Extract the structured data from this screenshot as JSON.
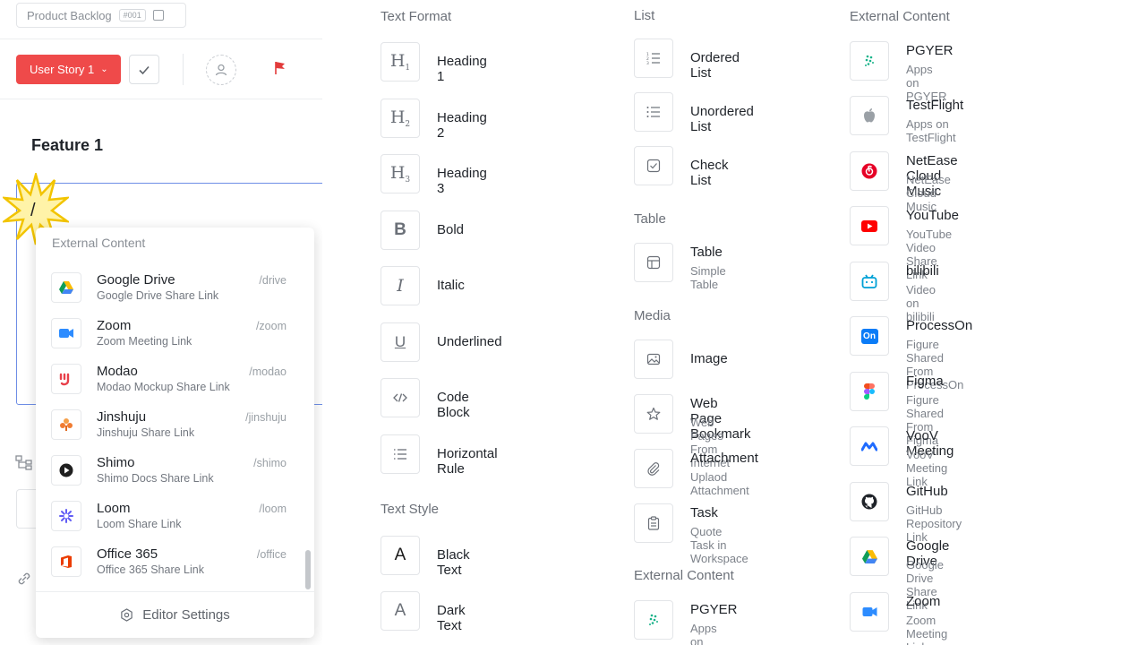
{
  "editor": {
    "breadcrumb": "Product Backlog",
    "breadcrumb_id": "#001",
    "story_button": "User Story 1",
    "feature_title": "Feature 1",
    "slash_input": "/"
  },
  "dropdown": {
    "heading": "External Content",
    "items": [
      {
        "name": "Google Drive",
        "sub": "Google Drive Share Link",
        "cmd": "/drive",
        "icon": "google-drive-icon"
      },
      {
        "name": "Zoom",
        "sub": "Zoom Meeting Link",
        "cmd": "/zoom",
        "icon": "zoom-icon"
      },
      {
        "name": "Modao",
        "sub": "Modao Mockup Share Link",
        "cmd": "/modao",
        "icon": "modao-icon"
      },
      {
        "name": "Jinshuju",
        "sub": "Jinshuju Share Link",
        "cmd": "/jinshuju",
        "icon": "jinshuju-icon"
      },
      {
        "name": "Shimo",
        "sub": "Shimo Docs Share Link",
        "cmd": "/shimo",
        "icon": "shimo-icon"
      },
      {
        "name": "Loom",
        "sub": "Loom Share Link",
        "cmd": "/loom",
        "icon": "loom-icon"
      },
      {
        "name": "Office 365",
        "sub": "Office 365 Share Link",
        "cmd": "/office",
        "icon": "office-365-icon"
      }
    ],
    "footer": "Editor Settings"
  },
  "col1": {
    "text_format_heading": "Text Format",
    "text_format": [
      {
        "name": "Heading 1",
        "icon": "heading-1-icon"
      },
      {
        "name": "Heading 2",
        "icon": "heading-2-icon"
      },
      {
        "name": "Heading 3",
        "icon": "heading-3-icon"
      },
      {
        "name": "Bold",
        "icon": "bold-icon"
      },
      {
        "name": "Italic",
        "icon": "italic-icon"
      },
      {
        "name": "Underlined",
        "icon": "underline-icon"
      },
      {
        "name": "Code Block",
        "icon": "code-block-icon"
      },
      {
        "name": "Horizontal Rule",
        "icon": "horizontal-rule-icon"
      }
    ],
    "text_style_heading": "Text Style",
    "text_style": [
      {
        "name": "Black Text",
        "icon": "black-text-icon"
      },
      {
        "name": "Dark Text",
        "icon": "dark-text-icon"
      }
    ]
  },
  "col2": {
    "list_heading": "List",
    "list": [
      {
        "name": "Ordered List",
        "icon": "ordered-list-icon"
      },
      {
        "name": "Unordered List",
        "icon": "unordered-list-icon"
      },
      {
        "name": "Check List",
        "icon": "check-list-icon"
      }
    ],
    "table_heading": "Table",
    "table": [
      {
        "name": "Table",
        "sub": "Simple Table",
        "icon": "table-icon"
      }
    ],
    "media_heading": "Media",
    "media": [
      {
        "name": "Image",
        "icon": "image-icon"
      },
      {
        "name": "Web Page Bookmark",
        "sub": "Web Pages From Internet",
        "icon": "star-icon"
      },
      {
        "name": "Attachment",
        "sub": "Uplaod Attachment",
        "icon": "paperclip-icon"
      },
      {
        "name": "Task",
        "sub": "Quote Task in Workspace",
        "icon": "clipboard-icon"
      }
    ],
    "external_heading": "External Content",
    "external": [
      {
        "name": "PGYER",
        "sub": "Apps on PGYER",
        "icon": "pgyer-icon"
      }
    ]
  },
  "col3": {
    "heading": "External Content",
    "items": [
      {
        "name": "PGYER",
        "sub": "Apps on PGYER",
        "icon": "pgyer-icon"
      },
      {
        "name": "TestFlight",
        "sub": "Apps on TestFlight",
        "icon": "apple-icon"
      },
      {
        "name": "NetEase Cloud Music",
        "sub": "NetEase Cloud Music",
        "icon": "netease-music-icon"
      },
      {
        "name": "YouTube",
        "sub": "YouTube Video Share Link",
        "icon": "youtube-icon"
      },
      {
        "name": "bilibili",
        "sub": "Video on bilibili",
        "icon": "bilibili-icon"
      },
      {
        "name": "ProcessOn",
        "sub": "Figure Shared From ProcessOn",
        "icon": "processon-icon"
      },
      {
        "name": "Figma",
        "sub": "Figure Shared From Figma",
        "icon": "figma-icon"
      },
      {
        "name": "VooV Meeting",
        "sub": "VooV Meeting Link",
        "icon": "voov-meeting-icon"
      },
      {
        "name": "GitHub",
        "sub": "GitHub Repository Link",
        "icon": "github-icon"
      },
      {
        "name": "Google Drive",
        "sub": "Google Drive Share Link",
        "icon": "google-drive-icon"
      },
      {
        "name": "Zoom",
        "sub": "Zoom Meeting Link",
        "icon": "zoom-icon"
      }
    ]
  },
  "colors": {
    "primary_red": "#ef4a4a",
    "focus_blue": "#6e8ee6"
  }
}
